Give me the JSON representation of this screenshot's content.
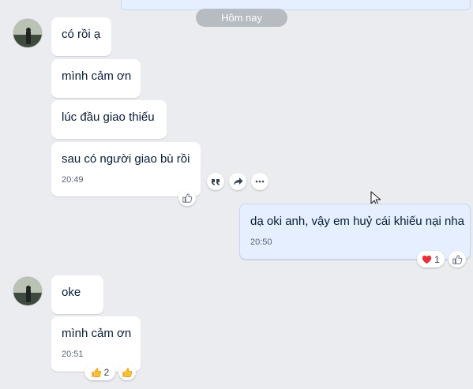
{
  "date_divider": "Hôm nay",
  "messages": {
    "m1": "có rồi ạ",
    "m2": "mình cảm ơn",
    "m3": "lúc đầu giao thiếu",
    "m4": "sau có người giao bù rồi",
    "m4_time": "20:49",
    "m5": "dạ oki anh, vậy em huỷ cái khiếu nại nha",
    "m5_time": "20:50",
    "m6": "oke",
    "m7": "mình cảm ơn",
    "m7_time": "20:51"
  },
  "reactions": {
    "m5_heart_count": "1",
    "m7_thumbs_count": "2"
  },
  "icons": {
    "quote": "quote-icon",
    "forward": "forward-icon",
    "more": "more-icon",
    "like": "like-icon"
  },
  "colors": {
    "background": "#ebecf0",
    "mine_bubble": "#e5efff",
    "their_bubble": "#ffffff",
    "divider": "#b7bbc2",
    "heart": "#e8303a"
  }
}
